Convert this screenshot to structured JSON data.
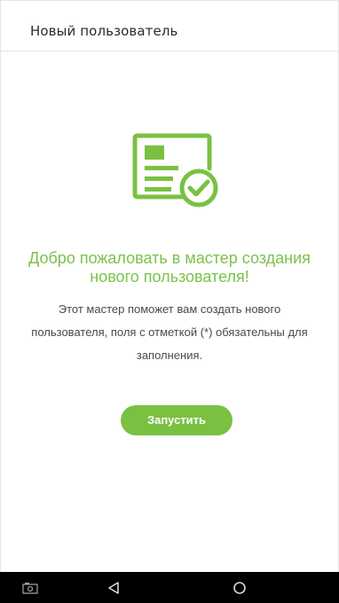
{
  "header": {
    "title": "Новый пользователь"
  },
  "hero": {
    "icon": "user-card-check-icon",
    "color": "#7ac142"
  },
  "welcome": {
    "title_line1": "Добро пожаловать в мастер создания",
    "title_line2": "нового пользователя!",
    "desc_line1": "Этот мастер поможет вам создать нового",
    "desc_line2": "пользователя, поля с отметкой (*) обязательны для",
    "desc_line3": "заполнения."
  },
  "actions": {
    "start_label": "Запустить"
  },
  "navbar": {
    "items": [
      "screenshot-icon",
      "back-icon",
      "home-icon"
    ],
    "background": "#000000"
  }
}
